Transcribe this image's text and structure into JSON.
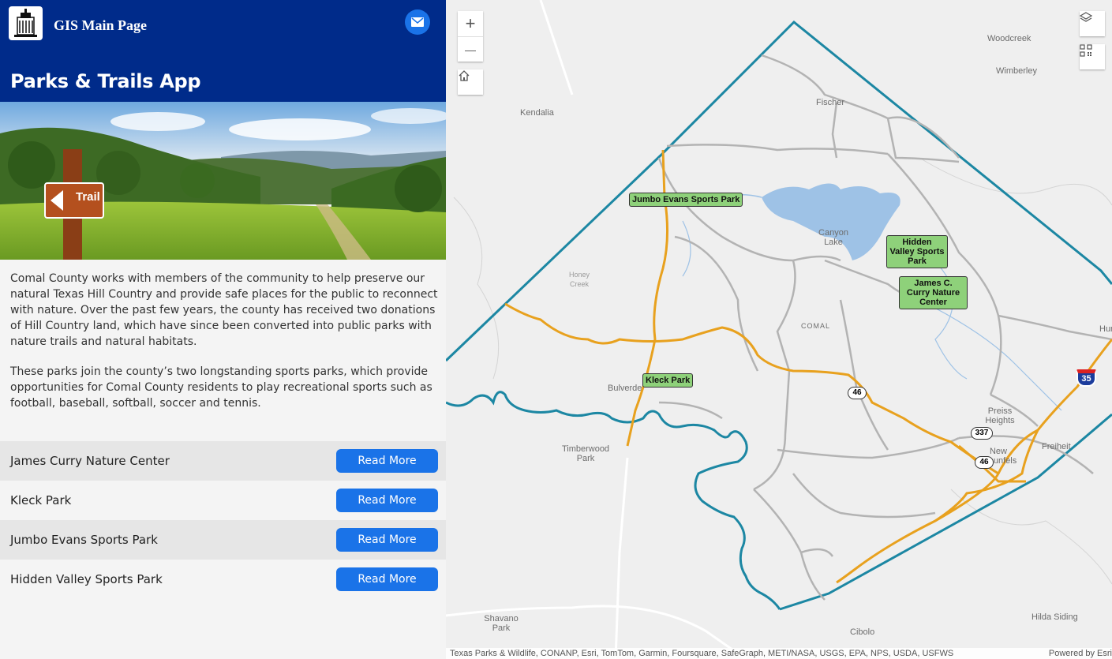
{
  "header": {
    "site_title": "GIS Main Page",
    "app_title": "Parks & Trails App",
    "mail_icon": "mail-icon"
  },
  "hero": {
    "sign_text": "Trail"
  },
  "description": {
    "p1": "Comal County works with members of the community to help preserve our natural Texas Hill Country and provide safe places for the public to reconnect with nature. Over the past few years, the county has received two donations of Hill Country land, which have since been converted into public parks with nature trails and natural habitats.",
    "p2": "These parks join the county’s two longstanding sports parks, which provide opportunities for Comal County residents to play recreational sports such as football, baseball, softball, soccer and tennis."
  },
  "parks": [
    {
      "name": "James Curry Nature Center",
      "button": "Read More"
    },
    {
      "name": "Kleck Park",
      "button": "Read More"
    },
    {
      "name": "Jumbo Evans Sports Park",
      "button": "Read More"
    },
    {
      "name": "Hidden Valley Sports Park",
      "button": "Read More"
    }
  ],
  "map": {
    "zoom_in": "+",
    "zoom_out": "—",
    "places": {
      "woodcreek": "Woodcreek",
      "wimberley": "Wimberley",
      "fischer": "Fischer",
      "kendalia": "Kendalia",
      "canyon_lake": "Canyon Lake",
      "honey_creek": "Honey Creek",
      "comal": "COMAL",
      "bulverde": "Bulverde",
      "timberwood": "Timberwood Park",
      "preiss": "Preiss Heights",
      "new_braunfels": "New Braunfels",
      "freiheit": "Freiheit",
      "hunter": "Hun",
      "shavano": "Shavano Park",
      "cibolo": "Cibolo",
      "hilda": "Hilda Siding"
    },
    "park_labels": {
      "jumbo": "Jumbo Evans Sports Park",
      "hidden": "Hidden Valley Sports Park",
      "curry": "James C. Curry Nature Center",
      "kleck": "Kleck Park"
    },
    "shields": {
      "s46a": "46",
      "s337": "337",
      "s46b": "46",
      "i35": "35"
    },
    "attribution": "Texas Parks & Wildlife, CONANP, Esri, TomTom, Garmin, Foursquare, SafeGraph, METI/NASA, USGS, EPA, NPS, USDA, USFWS",
    "powered": "Powered by Esri"
  }
}
